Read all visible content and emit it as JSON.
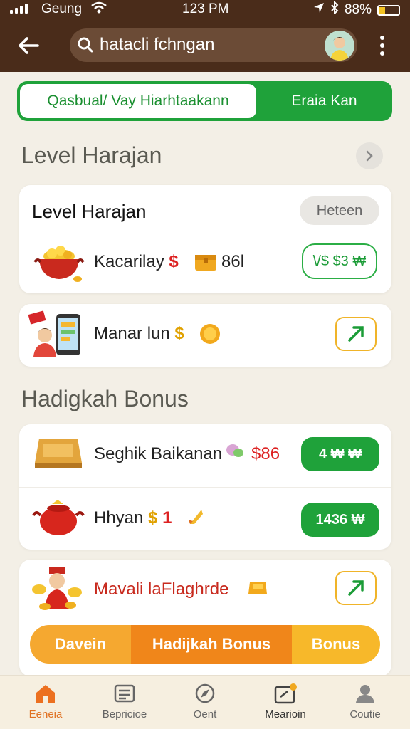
{
  "status_bar": {
    "carrier": "Geung",
    "time": "123 PM",
    "battery": "88%"
  },
  "header": {
    "search_value": "hatacli fchngan"
  },
  "tabs": {
    "left": "Qasbual/ Vay Hiarhtaakann",
    "right": "Eraia Kan"
  },
  "level_section": {
    "title": "Level Harajan",
    "card_title": "Level Harajan",
    "card_pill": "Heteen",
    "rows": [
      {
        "label": "Kacarilay",
        "symbol": "$",
        "value": "86l",
        "button": "\\/$ $3 ₩"
      },
      {
        "label": "Manar lun",
        "symbol": "$"
      }
    ]
  },
  "bonus_section": {
    "title": "Hadigkah Bonus",
    "rows": [
      {
        "label": "Seghik Baikanan",
        "value": "$86",
        "button": "4 ₩ ₩"
      },
      {
        "label": "Hhyan",
        "symbol": "$",
        "value": "1",
        "button": "1436 ₩"
      }
    ],
    "promo": {
      "label": "Mavali laFlaghrde",
      "segments": [
        "Davein",
        "Hadijkah Bonus",
        "Bonus"
      ]
    }
  },
  "bottom_nav": [
    {
      "label": "Eeneia",
      "icon": "home-icon",
      "active": true
    },
    {
      "label": "Bepricioe",
      "icon": "list-icon",
      "active": false
    },
    {
      "label": "Oent",
      "icon": "compass-icon",
      "active": false
    },
    {
      "label": "Mearioin",
      "icon": "wallet-icon",
      "active": false
    },
    {
      "label": "Coutie",
      "icon": "profile-icon",
      "active": false
    }
  ],
  "colors": {
    "header_bg": "#4a2c1a",
    "accent_green": "#1fa23a",
    "accent_orange": "#f08a20",
    "background": "#f3efe6"
  }
}
